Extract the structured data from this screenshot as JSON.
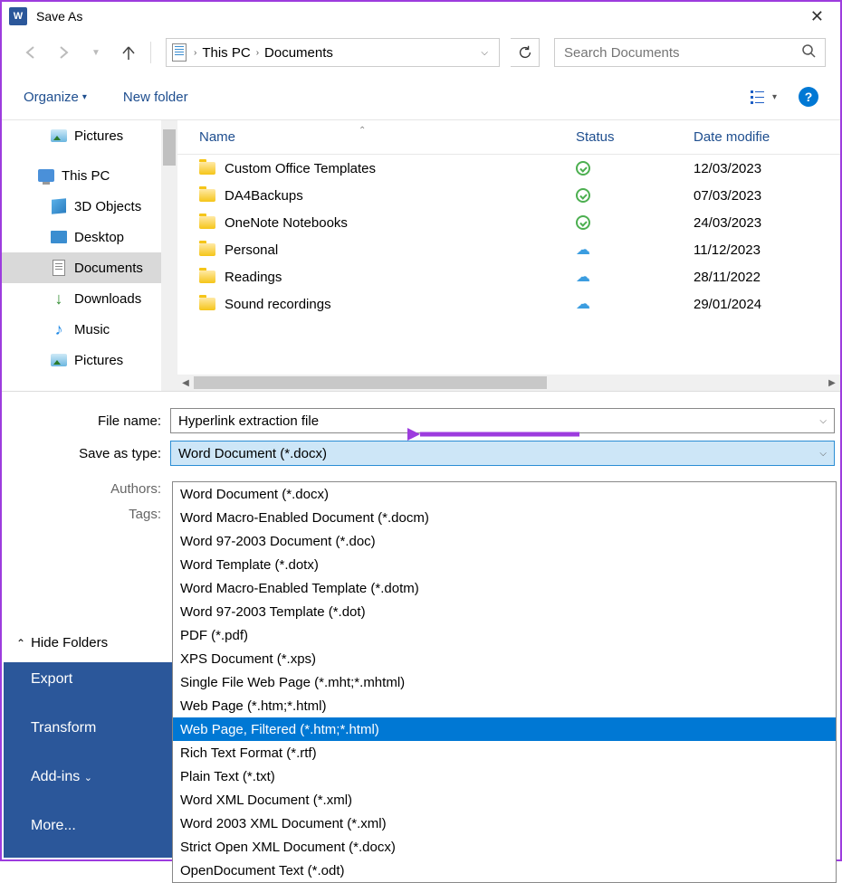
{
  "window": {
    "title": "Save As"
  },
  "breadcrumb": {
    "root": "This PC",
    "folder": "Documents"
  },
  "search": {
    "placeholder": "Search Documents"
  },
  "toolbar": {
    "organize": "Organize",
    "new_folder": "New folder"
  },
  "columns": {
    "name": "Name",
    "status": "Status",
    "date": "Date modifie"
  },
  "sidebar": {
    "items": [
      {
        "label": "Pictures",
        "icon": "pictures"
      },
      {
        "label": "This PC",
        "icon": "pc"
      },
      {
        "label": "3D Objects",
        "icon": "3d"
      },
      {
        "label": "Desktop",
        "icon": "desktop"
      },
      {
        "label": "Documents",
        "icon": "documents",
        "selected": true
      },
      {
        "label": "Downloads",
        "icon": "downloads"
      },
      {
        "label": "Music",
        "icon": "music"
      },
      {
        "label": "Pictures",
        "icon": "pictures"
      }
    ]
  },
  "files": [
    {
      "name": "Custom Office Templates",
      "status": "sync",
      "date": "12/03/2023"
    },
    {
      "name": "DA4Backups",
      "status": "sync",
      "date": "07/03/2023"
    },
    {
      "name": "OneNote Notebooks",
      "status": "sync",
      "date": "24/03/2023"
    },
    {
      "name": "Personal",
      "status": "cloud",
      "date": "11/12/2023"
    },
    {
      "name": "Readings",
      "status": "cloud",
      "date": "28/11/2022"
    },
    {
      "name": "Sound recordings",
      "status": "cloud",
      "date": "29/01/2024"
    }
  ],
  "form": {
    "filename_label": "File name:",
    "filename_value": "Hyperlink extraction file",
    "savetype_label": "Save as type:",
    "savetype_value": "Word Document (*.docx)",
    "authors_label": "Authors:",
    "tags_label": "Tags:"
  },
  "type_options": [
    "Word Document (*.docx)",
    "Word Macro-Enabled Document (*.docm)",
    "Word 97-2003 Document (*.doc)",
    "Word Template (*.dotx)",
    "Word Macro-Enabled Template (*.dotm)",
    "Word 97-2003 Template (*.dot)",
    "PDF (*.pdf)",
    "XPS Document (*.xps)",
    "Single File Web Page (*.mht;*.mhtml)",
    "Web Page (*.htm;*.html)",
    "Web Page, Filtered (*.htm;*.html)",
    "Rich Text Format (*.rtf)",
    "Plain Text (*.txt)",
    "Word XML Document (*.xml)",
    "Word 2003 XML Document (*.xml)",
    "Strict Open XML Document (*.docx)",
    "OpenDocument Text (*.odt)"
  ],
  "type_highlighted_index": 10,
  "hide_folders": "Hide Folders",
  "backstage": {
    "export": "Export",
    "transform": "Transform",
    "addins": "Add-ins",
    "more": "More..."
  }
}
